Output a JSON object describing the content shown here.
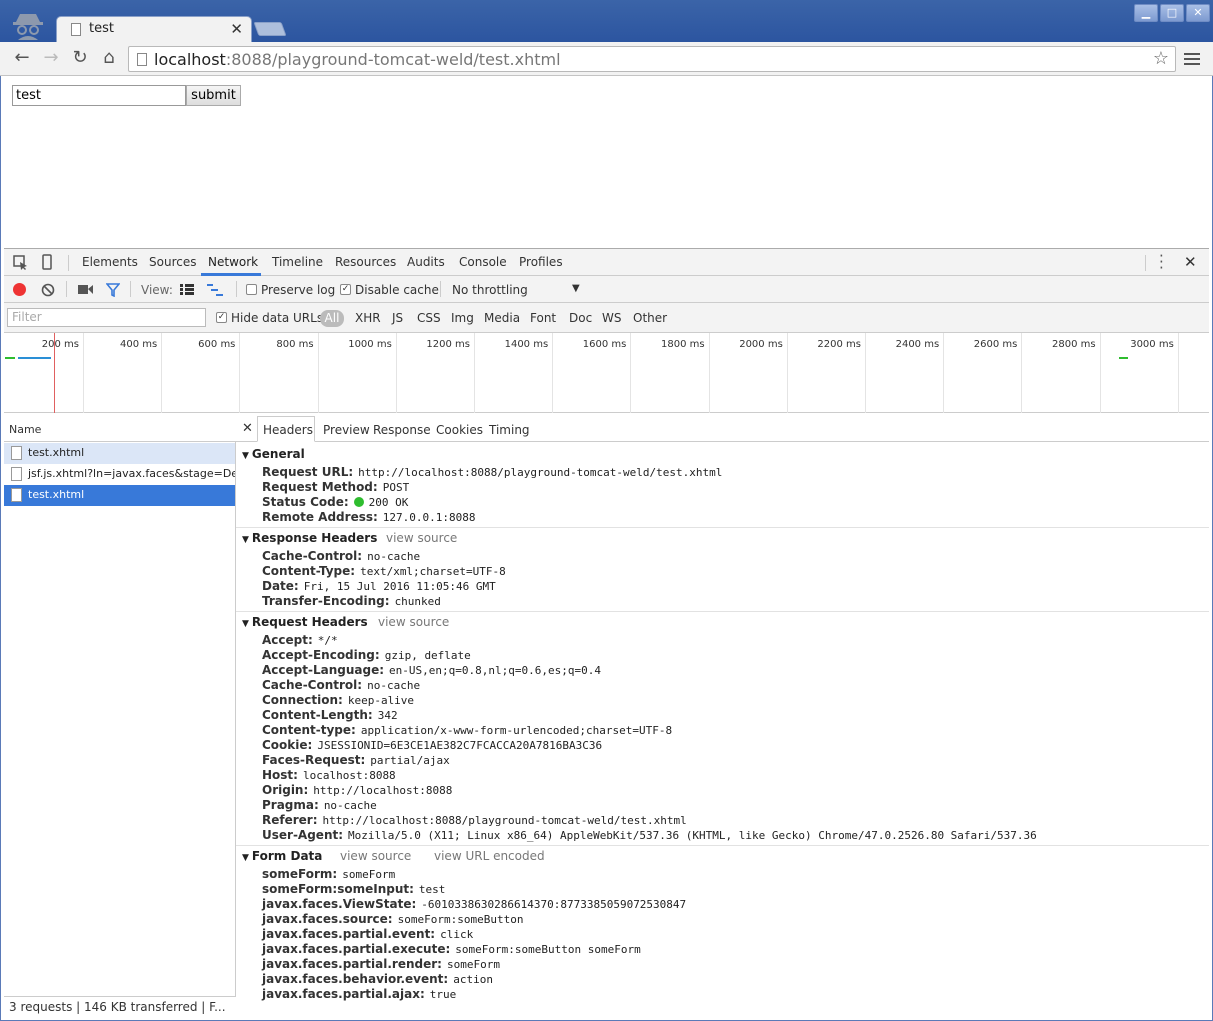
{
  "browser": {
    "tab_title": "test",
    "url_host": "localhost",
    "url_rest": ":8088/playground-tomcat-weld/test.xhtml"
  },
  "page": {
    "input_value": "test",
    "submit_label": "submit"
  },
  "devtools": {
    "tabs": [
      "Elements",
      "Sources",
      "Network",
      "Timeline",
      "Resources",
      "Audits",
      "Console",
      "Profiles"
    ],
    "view_label": "View:",
    "preserve_log": "Preserve log",
    "disable_cache": "Disable cache",
    "throttling": "No throttling",
    "filter_placeholder": "Filter",
    "hide_data_urls": "Hide data URLs",
    "types": [
      "All",
      "XHR",
      "JS",
      "CSS",
      "Img",
      "Media",
      "Font",
      "Doc",
      "WS",
      "Other"
    ],
    "timeline_ticks": [
      "200 ms",
      "400 ms",
      "600 ms",
      "800 ms",
      "1000 ms",
      "1200 ms",
      "1400 ms",
      "1600 ms",
      "1800 ms",
      "2000 ms",
      "2200 ms",
      "2400 ms",
      "2600 ms",
      "2800 ms",
      "3000 ms"
    ],
    "name_header": "Name",
    "requests": [
      "test.xhtml",
      "jsf.js.xhtml?ln=javax.faces&stage=Dev...",
      "test.xhtml"
    ],
    "status": "3 requests  |  146 KB transferred  |  F...",
    "detail_tabs": [
      "Headers",
      "Preview",
      "Response",
      "Cookies",
      "Timing"
    ],
    "view_source": "view source",
    "view_url_encoded": "view URL encoded",
    "general": {
      "title": "General",
      "rows": [
        {
          "k": "Request URL:",
          "v": "http://localhost:8088/playground-tomcat-weld/test.xhtml"
        },
        {
          "k": "Request Method:",
          "v": "POST"
        },
        {
          "k": "Status Code:",
          "v": "200 OK"
        },
        {
          "k": "Remote Address:",
          "v": "127.0.0.1:8088"
        }
      ]
    },
    "response_headers": {
      "title": "Response Headers",
      "rows": [
        {
          "k": "Cache-Control:",
          "v": "no-cache"
        },
        {
          "k": "Content-Type:",
          "v": "text/xml;charset=UTF-8"
        },
        {
          "k": "Date:",
          "v": "Fri, 15 Jul 2016 11:05:46 GMT"
        },
        {
          "k": "Transfer-Encoding:",
          "v": "chunked"
        }
      ]
    },
    "request_headers": {
      "title": "Request Headers",
      "rows": [
        {
          "k": "Accept:",
          "v": "*/*"
        },
        {
          "k": "Accept-Encoding:",
          "v": "gzip, deflate"
        },
        {
          "k": "Accept-Language:",
          "v": "en-US,en;q=0.8,nl;q=0.6,es;q=0.4"
        },
        {
          "k": "Cache-Control:",
          "v": "no-cache"
        },
        {
          "k": "Connection:",
          "v": "keep-alive"
        },
        {
          "k": "Content-Length:",
          "v": "342"
        },
        {
          "k": "Content-type:",
          "v": "application/x-www-form-urlencoded;charset=UTF-8"
        },
        {
          "k": "Cookie:",
          "v": "JSESSIONID=6E3CE1AE382C7FCACCA20A7816BA3C36"
        },
        {
          "k": "Faces-Request:",
          "v": "partial/ajax"
        },
        {
          "k": "Host:",
          "v": "localhost:8088"
        },
        {
          "k": "Origin:",
          "v": "http://localhost:8088"
        },
        {
          "k": "Pragma:",
          "v": "no-cache"
        },
        {
          "k": "Referer:",
          "v": "http://localhost:8088/playground-tomcat-weld/test.xhtml"
        },
        {
          "k": "User-Agent:",
          "v": "Mozilla/5.0 (X11; Linux x86_64) AppleWebKit/537.36 (KHTML, like Gecko) Chrome/47.0.2526.80 Safari/537.36"
        }
      ]
    },
    "form_data": {
      "title": "Form Data",
      "rows": [
        {
          "k": "someForm:",
          "v": "someForm"
        },
        {
          "k": "someForm:someInput:",
          "v": "test"
        },
        {
          "k": "javax.faces.ViewState:",
          "v": "-6010338630286614370:8773385059072530847"
        },
        {
          "k": "javax.faces.source:",
          "v": "someForm:someButton"
        },
        {
          "k": "javax.faces.partial.event:",
          "v": "click"
        },
        {
          "k": "javax.faces.partial.execute:",
          "v": "someForm:someButton someForm"
        },
        {
          "k": "javax.faces.partial.render:",
          "v": "someForm"
        },
        {
          "k": "javax.faces.behavior.event:",
          "v": "action"
        },
        {
          "k": "javax.faces.partial.ajax:",
          "v": "true"
        }
      ]
    }
  }
}
